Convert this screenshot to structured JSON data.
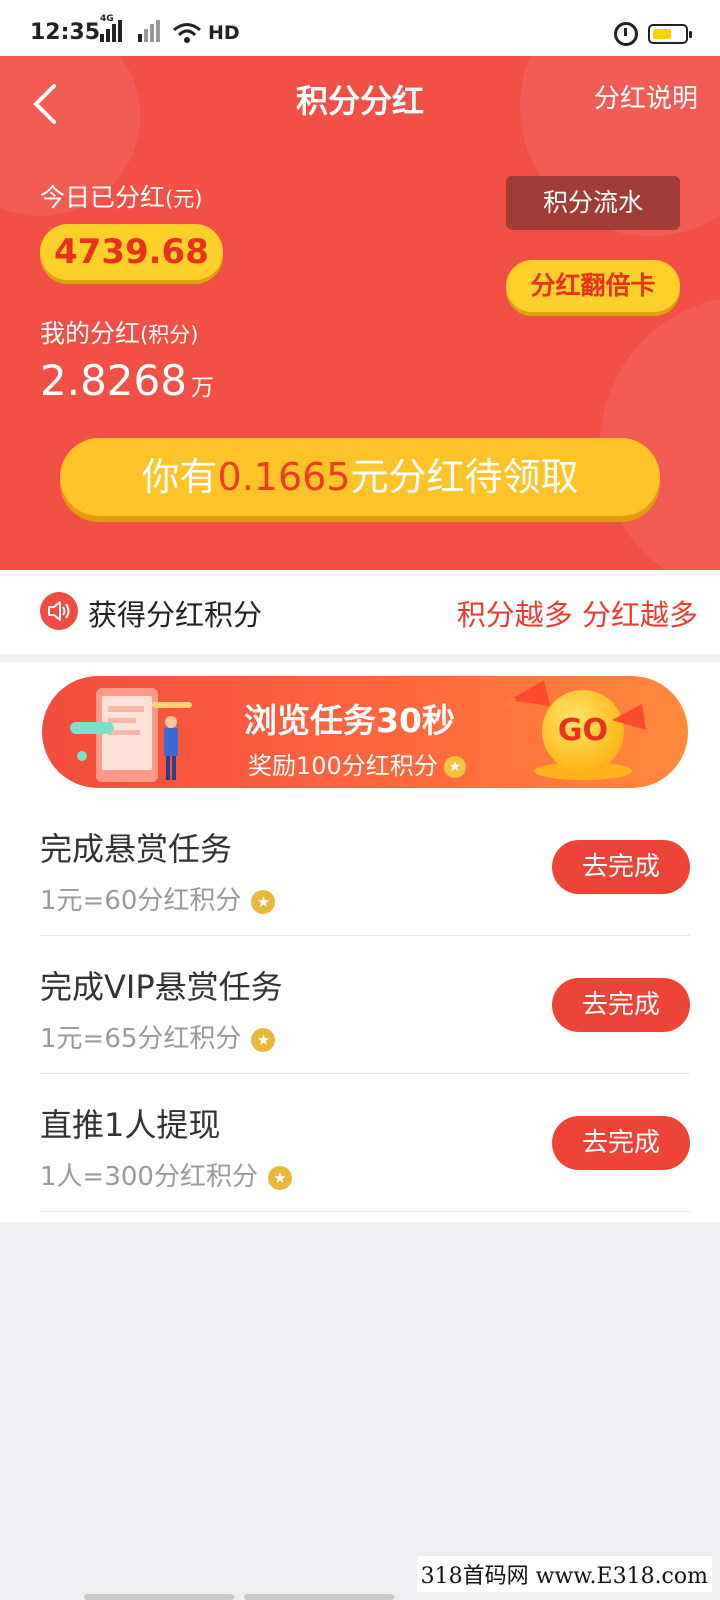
{
  "status_bar": {
    "time": "12:35",
    "network_tag": "4G",
    "hd": "HD",
    "icons": [
      "signal-icon",
      "wifi-icon",
      "alarm-icon",
      "battery-icon"
    ]
  },
  "header": {
    "title": "积分分红",
    "right_link": "分红说明",
    "today_label": "今日已分红",
    "today_unit": "(元)",
    "today_value": "4739.68",
    "flow_button": "积分流水",
    "double_card_button": "分红翻倍卡",
    "my_label": "我的分红",
    "my_unit": "(积分)",
    "my_value": "2.8268",
    "my_value_unit": "万",
    "claim": {
      "prefix": "你有",
      "amount": "0.1665",
      "suffix": "元分红待领取"
    }
  },
  "notice": {
    "text": "获得分红积分",
    "slogan": "积分越多 分红越多"
  },
  "banner": {
    "title": "浏览任务30秒",
    "subtitle": "奖励100分红积分",
    "go_label": "GO"
  },
  "tasks": [
    {
      "name": "完成悬赏任务",
      "reward": "1元=60分红积分",
      "button": "去完成"
    },
    {
      "name": "完成VIP悬赏任务",
      "reward": "1元=65分红积分",
      "button": "去完成"
    },
    {
      "name": "直推1人提现",
      "reward": "1人=300分红积分",
      "button": "去完成"
    }
  ],
  "watermark": "318首码网 www.E318.com",
  "colors": {
    "header_red": "#f25047",
    "accent_yellow": "#ffd02a",
    "button_red": "#ee4438",
    "background": "#efeff3"
  }
}
